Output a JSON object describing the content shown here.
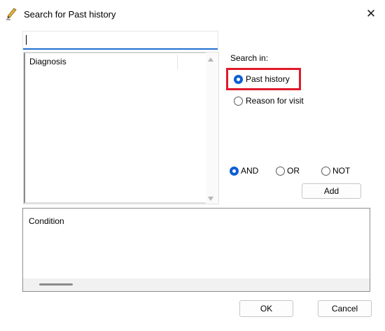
{
  "window": {
    "title": "Search for Past history",
    "close_label": "✕"
  },
  "search": {
    "value": "",
    "placeholder": ""
  },
  "list": {
    "column_header": "Diagnosis",
    "rows": []
  },
  "search_in": {
    "label": "Search in:",
    "options": [
      {
        "label": "Past history",
        "selected": true
      },
      {
        "label": "Reason for visit",
        "selected": false
      }
    ]
  },
  "operators": [
    {
      "label": "AND",
      "selected": true
    },
    {
      "label": "OR",
      "selected": false
    },
    {
      "label": "NOT",
      "selected": false
    }
  ],
  "buttons": {
    "add": "Add",
    "ok": "OK",
    "cancel": "Cancel"
  },
  "condition": {
    "label": "Condition"
  },
  "colors": {
    "accent": "#0d5fd6",
    "highlight": "#e01a2a",
    "input_underline": "#1f6fd0"
  },
  "icons": {
    "title": "pencil-icon"
  }
}
